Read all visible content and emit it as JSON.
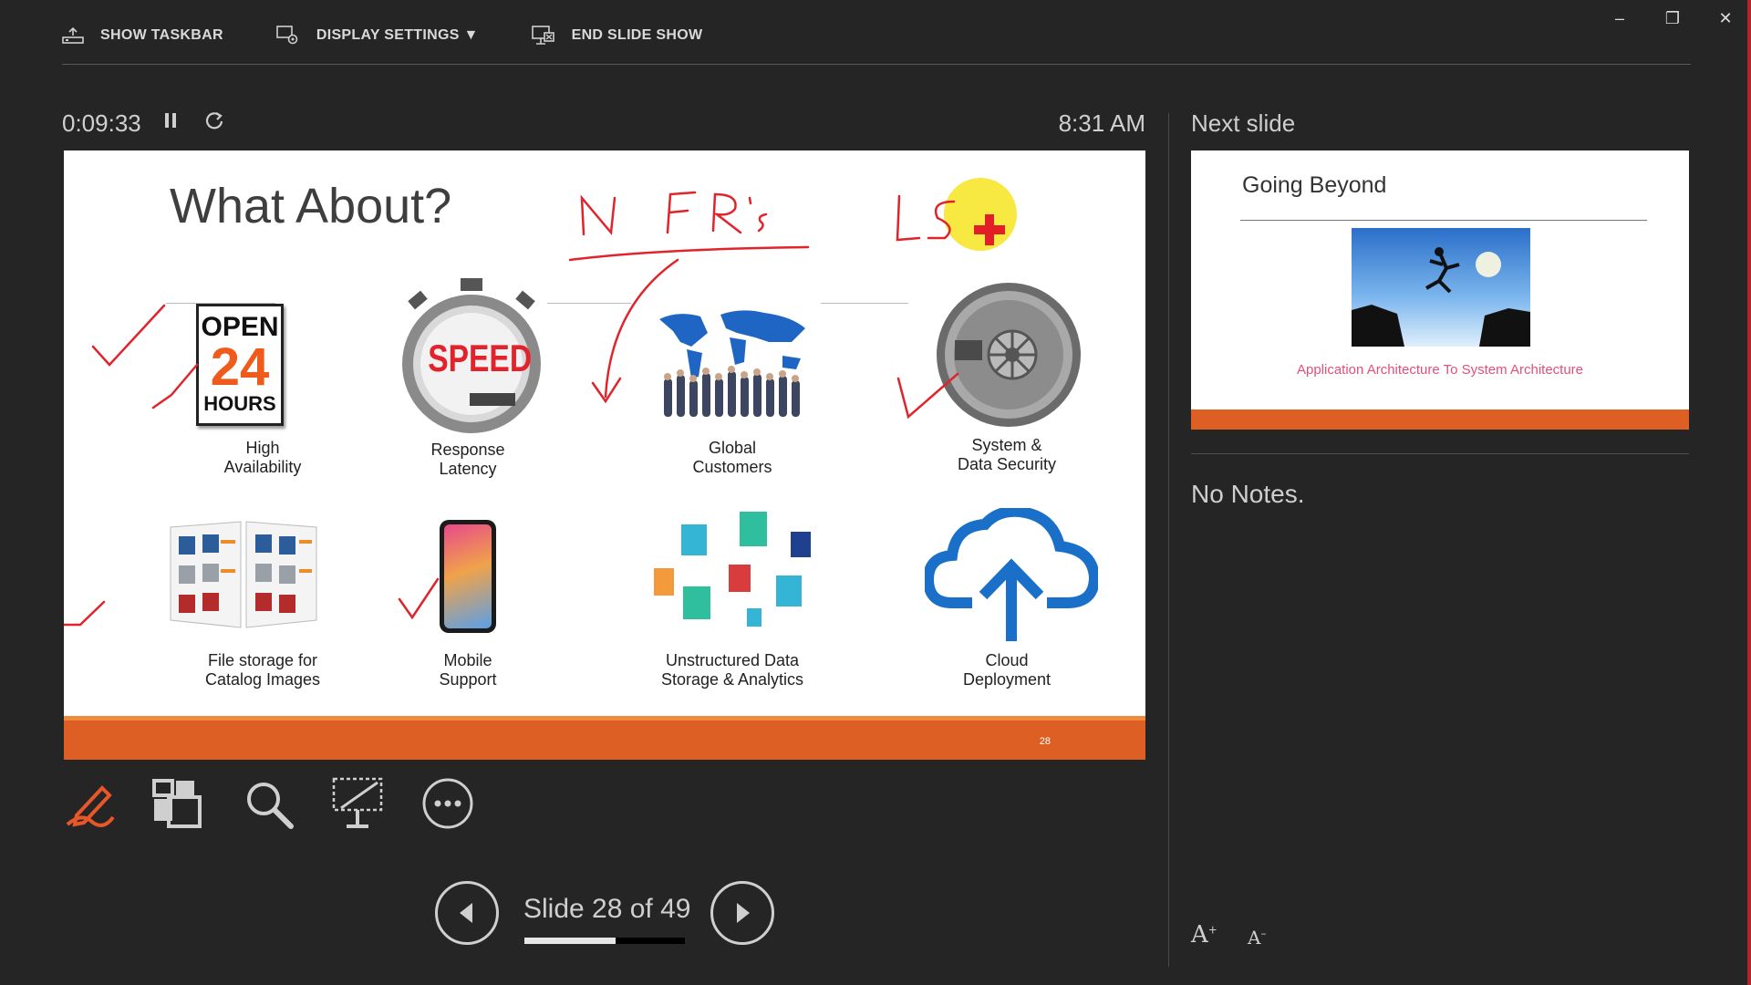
{
  "toolbar": {
    "show_taskbar": "SHOW TASKBAR",
    "display_settings": "DISPLAY SETTINGS ▼",
    "end_slide_show": "END SLIDE SHOW"
  },
  "window_controls": {
    "minimize": "–",
    "restore": "❐",
    "close": "✕"
  },
  "timer": {
    "elapsed": "0:09:33",
    "clock": "8:31 AM"
  },
  "slide": {
    "title": "What About?",
    "number": "28",
    "items": [
      {
        "caption_1": "High",
        "caption_2": "Availability"
      },
      {
        "caption_1": "Response",
        "caption_2": "Latency"
      },
      {
        "caption_1": "Global",
        "caption_2": "Customers"
      },
      {
        "caption_1": "System &",
        "caption_2": "Data Security"
      },
      {
        "caption_1": "File storage for",
        "caption_2": "Catalog Images"
      },
      {
        "caption_1": "Mobile",
        "caption_2": "Support"
      },
      {
        "caption_1": "Unstructured Data",
        "caption_2": "Storage & Analytics"
      },
      {
        "caption_1": "Cloud",
        "caption_2": "Deployment"
      }
    ],
    "sign_text": {
      "open": "OPEN",
      "hours_num": "24",
      "hours": "HOURS",
      "speed": "SPEED"
    },
    "ink_annotations": [
      "NFR's",
      "LS"
    ],
    "ink_color": "#e0242b",
    "highlighter_color": "#f6e72c"
  },
  "navigation": {
    "counter": "Slide 28 of 49",
    "progress": 0.57
  },
  "next_slide": {
    "label": "Next slide",
    "title": "Going Beyond",
    "subtitle": "Application Architecture To System Architecture"
  },
  "notes": {
    "text": "No Notes."
  },
  "font_controls": {
    "increase": "A",
    "decrease": "A"
  },
  "colors": {
    "accent": "#dd5f24",
    "background": "#252525"
  }
}
